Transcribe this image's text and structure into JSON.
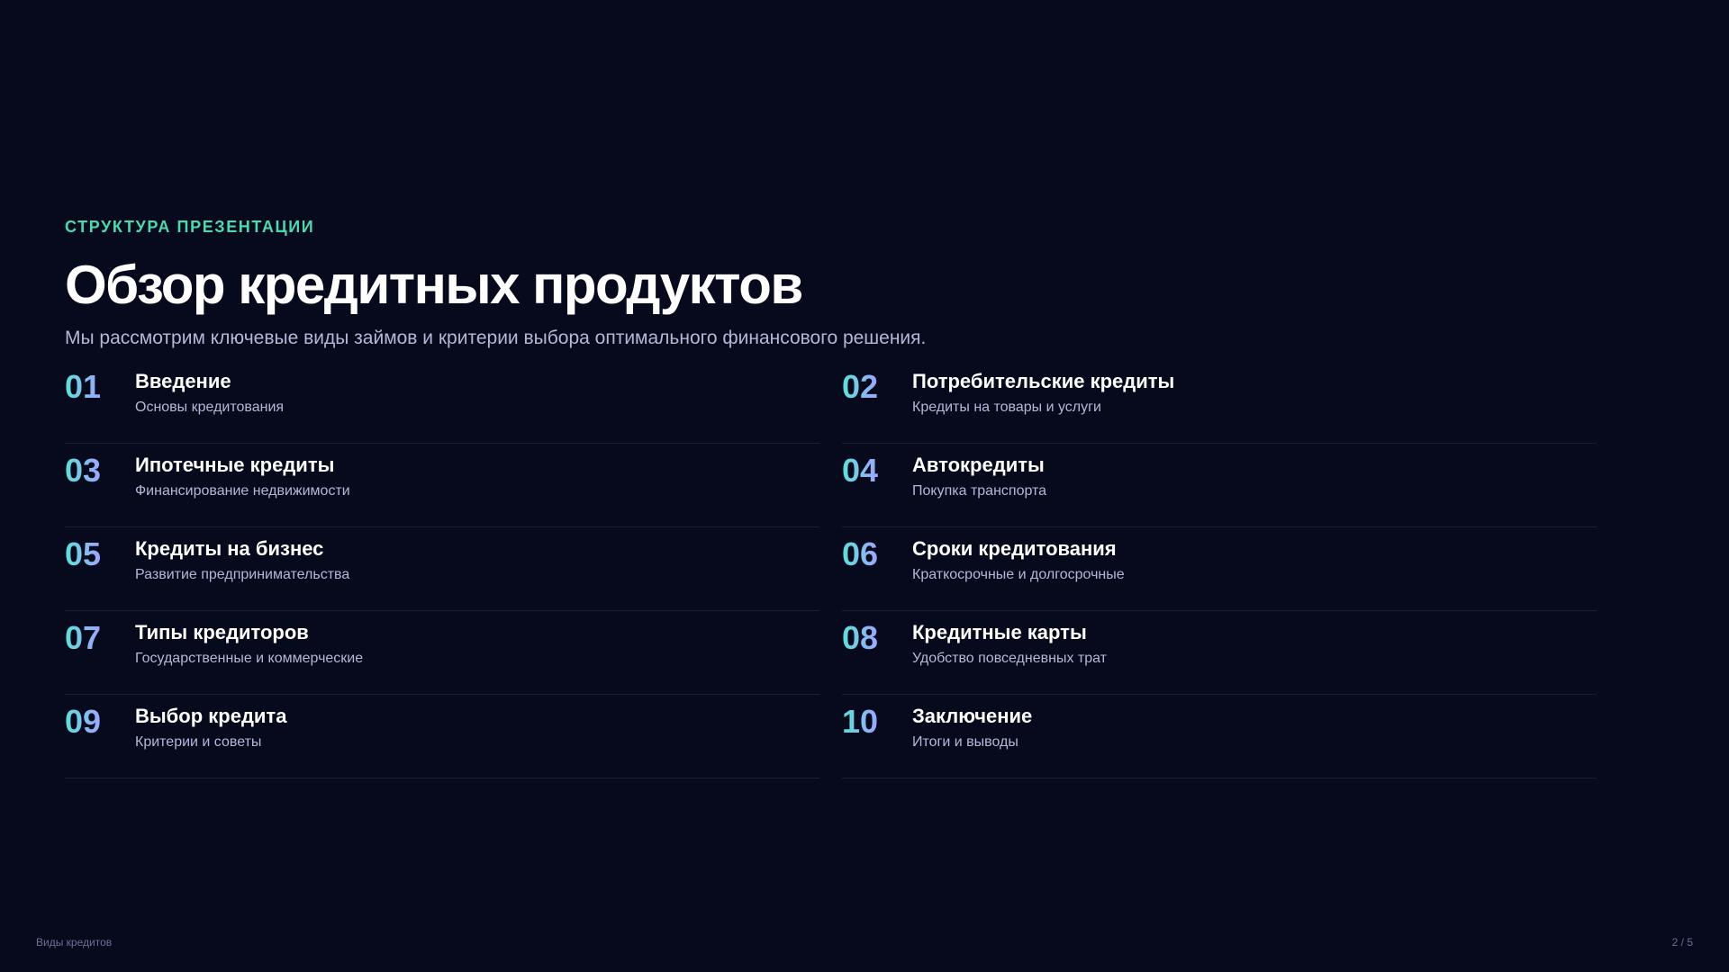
{
  "header": {
    "eyebrow": "СТРУКТУРА ПРЕЗЕНТАЦИИ",
    "title": "Обзор кредитных продуктов",
    "subtitle": "Мы рассмотрим ключевые виды займов и критерии выбора оптимального финансового решения."
  },
  "items": [
    {
      "num": "01",
      "title": "Введение",
      "desc": "Основы кредитования"
    },
    {
      "num": "02",
      "title": "Потребительские кредиты",
      "desc": "Кредиты на товары и услуги"
    },
    {
      "num": "03",
      "title": "Ипотечные кредиты",
      "desc": "Финансирование недвижимости"
    },
    {
      "num": "04",
      "title": "Автокредиты",
      "desc": "Покупка транспорта"
    },
    {
      "num": "05",
      "title": "Кредиты на бизнес",
      "desc": "Развитие предпринимательства"
    },
    {
      "num": "06",
      "title": "Сроки кредитования",
      "desc": "Краткосрочные и долгосрочные"
    },
    {
      "num": "07",
      "title": "Типы кредиторов",
      "desc": "Государственные и коммерческие"
    },
    {
      "num": "08",
      "title": "Кредитные карты",
      "desc": "Удобство повседневных трат"
    },
    {
      "num": "09",
      "title": "Выбор кредита",
      "desc": "Критерии и советы"
    },
    {
      "num": "10",
      "title": "Заключение",
      "desc": "Итоги и выводы"
    }
  ],
  "footer": {
    "left": "Виды кредитов",
    "page": "2 / 5"
  },
  "colors": {
    "background": "#060a1c",
    "accent": "#4fd8b0",
    "number_gradient_start": "#5ee0d8",
    "number_gradient_end": "#9fa4ff"
  }
}
